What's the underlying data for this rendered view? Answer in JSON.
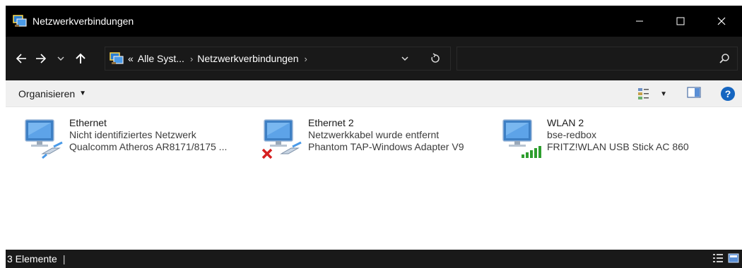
{
  "window": {
    "title": "Netzwerkverbindungen"
  },
  "address": {
    "overflow": "«",
    "crumbs": [
      "Alle Syst...",
      "Netzwerkverbindungen"
    ],
    "search_placeholder": ""
  },
  "toolbar": {
    "organize_label": "Organisieren",
    "help_label": "?"
  },
  "connections": [
    {
      "name": "Ethernet",
      "status": "Nicht identifiziertes Netzwerk",
      "adapter": "Qualcomm Atheros AR8171/8175 ...",
      "icon": "ethernet-connection-icon"
    },
    {
      "name": "Ethernet 2",
      "status": "Netzwerkkabel wurde entfernt",
      "adapter": "Phantom TAP-Windows Adapter V9",
      "icon": "ethernet-disconnected-icon"
    },
    {
      "name": "WLAN 2",
      "status": "bse-redbox",
      "adapter": "FRITZ!WLAN USB Stick AC 860",
      "icon": "wlan-connection-icon"
    }
  ],
  "statusbar": {
    "count": "3 Elemente",
    "separator": "|"
  },
  "colors": {
    "title_bg": "#000000",
    "address_bg": "#191919",
    "command_bg": "#f0f0f0",
    "help_blue": "#1565c0",
    "error_red": "#d62020",
    "signal_green": "#2e9e2e"
  }
}
